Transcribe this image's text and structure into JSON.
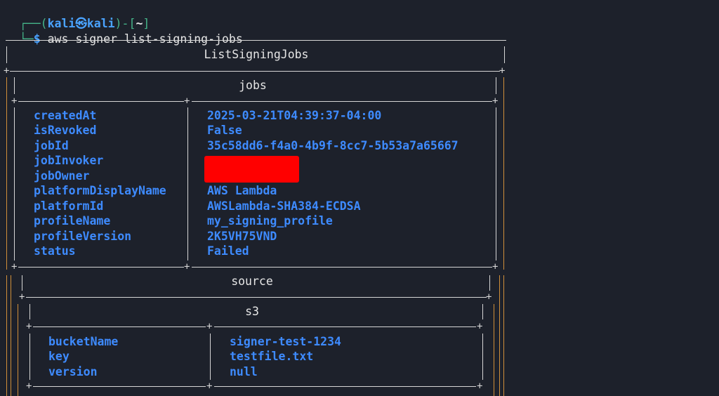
{
  "prompt": {
    "corner_top": "┌──(",
    "user": "kali",
    "at_icon": "㉿",
    "host": "kali",
    "close_paren": ")-[",
    "cwd": "~",
    "close_bracket": "]",
    "corner_bottom": "└─",
    "dollar": "$",
    "command": "aws signer list-signing-jobs"
  },
  "table": {
    "title": "ListSigningJobs",
    "jobs_header": "jobs",
    "jobs": [
      {
        "key": "createdAt",
        "value": "2025-03-21T04:39:37-04:00"
      },
      {
        "key": "isRevoked",
        "value": "False"
      },
      {
        "key": "jobId",
        "value": "35c58dd6-f4a0-4b9f-8cc7-5b53a7a65667"
      },
      {
        "key": "jobInvoker",
        "value": ""
      },
      {
        "key": "jobOwner",
        "value": ""
      },
      {
        "key": "platformDisplayName",
        "value": "AWS Lambda"
      },
      {
        "key": "platformId",
        "value": "AWSLambda-SHA384-ECDSA"
      },
      {
        "key": "profileName",
        "value": "my_signing_profile"
      },
      {
        "key": "profileVersion",
        "value": "2K5VH75VND"
      },
      {
        "key": "status",
        "value": "Failed"
      }
    ],
    "source_header": "source",
    "s3_header": "s3",
    "s3": [
      {
        "key": "bucketName",
        "value": "signer-test-1234"
      },
      {
        "key": "key",
        "value": "testfile.txt"
      },
      {
        "key": "version",
        "value": "null"
      }
    ]
  },
  "colors": {
    "background": "#1d212b",
    "prompt_green": "#45b58a",
    "key_blue": "#3e8bff",
    "border_orange": "#d08f3a",
    "redaction_red": "#ff0000"
  }
}
